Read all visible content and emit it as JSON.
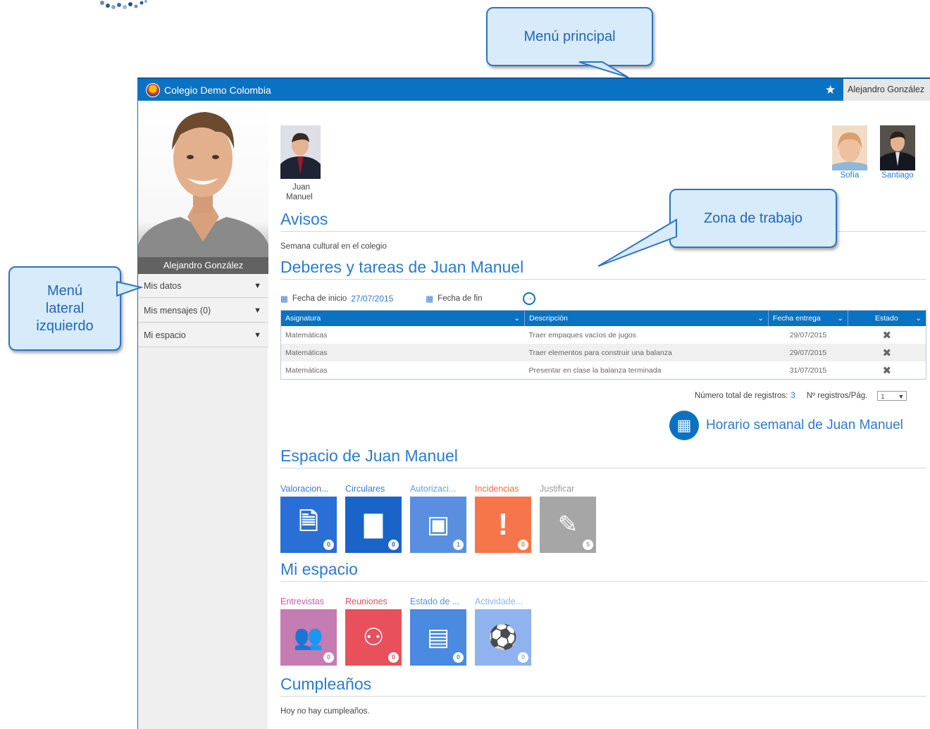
{
  "callouts": {
    "main_menu": "Menú principal",
    "work_zone": "Zona de trabajo",
    "left_menu": [
      "Menú",
      "lateral",
      "izquierdo"
    ]
  },
  "topbar": {
    "school": "Colegio Demo Colombia",
    "user": "Alejandro González"
  },
  "sidebar": {
    "profile_name": "Alejandro González",
    "items": [
      {
        "label": "Mis datos"
      },
      {
        "label": "Mis mensajes (0)"
      },
      {
        "label": "Mi espacio"
      }
    ]
  },
  "children": {
    "current": [
      "Juan",
      "Manuel"
    ],
    "others": [
      "Sofía",
      "Santiago"
    ]
  },
  "avisos": {
    "title": "Avisos",
    "text": "Semana cultural en el colegio"
  },
  "deberes": {
    "title": "Deberes y tareas de Juan Manuel",
    "fecha_inicio_label": "Fecha de inicio",
    "fecha_inicio_value": "27/07/2015",
    "fecha_fin_label": "Fecha de fin",
    "columns": [
      "Asignatura",
      "Descripción",
      "Fecha entrega",
      "Estado"
    ],
    "rows": [
      {
        "asignatura": "Matemáticas",
        "descripcion": "Traer empaques vacíos de jugos",
        "fecha": "29/07/2015"
      },
      {
        "asignatura": "Matemáticas",
        "descripcion": "Traer elementos para construir una balanza",
        "fecha": "29/07/2015"
      },
      {
        "asignatura": "Matemáticas",
        "descripcion": "Presentar en clase la balanza terminada",
        "fecha": "31/07/2015"
      }
    ],
    "total_label": "Número total de registros:",
    "total_value": "3",
    "per_page_label": "Nº registros/Pág.",
    "per_page_value": "1"
  },
  "horario": {
    "label": "Horario semanal de Juan Manuel"
  },
  "espacio": {
    "title": "Espacio de Juan Manuel",
    "tiles": [
      {
        "label": "Valoracion...",
        "count": "0",
        "color": "#2a6fd6",
        "label_color": "#3a7bd5"
      },
      {
        "label": "Circulares",
        "count": "0",
        "color": "#1a64c8",
        "label_color": "#3a7bd5"
      },
      {
        "label": "Autorizaci...",
        "count": "1",
        "color": "#5a8fe0",
        "label_color": "#6a9ae0"
      },
      {
        "label": "Incidencias",
        "count": "0",
        "color": "#f4764a",
        "label_color": "#f06a45"
      },
      {
        "label": "Justificar",
        "count": "5",
        "color": "#a6a6a6",
        "label_color": "#999999"
      }
    ]
  },
  "mi_espacio": {
    "title": "Mi espacio",
    "tiles": [
      {
        "label": "Entrevistas",
        "count": "0",
        "color": "#c47cb3",
        "label_color": "#c060a8"
      },
      {
        "label": "Reuniones",
        "count": "0",
        "color": "#e8505c",
        "label_color": "#e0505c"
      },
      {
        "label": "Estado de ...",
        "count": "0",
        "color": "#4a8ae0",
        "label_color": "#5a8fe0"
      },
      {
        "label": "Actividade...",
        "count": "0",
        "color": "#8fb3ee",
        "label_color": "#8fb3ee"
      }
    ]
  },
  "cumpleanos": {
    "title": "Cumpleaños",
    "text": "Hoy no hay cumpleaños."
  }
}
